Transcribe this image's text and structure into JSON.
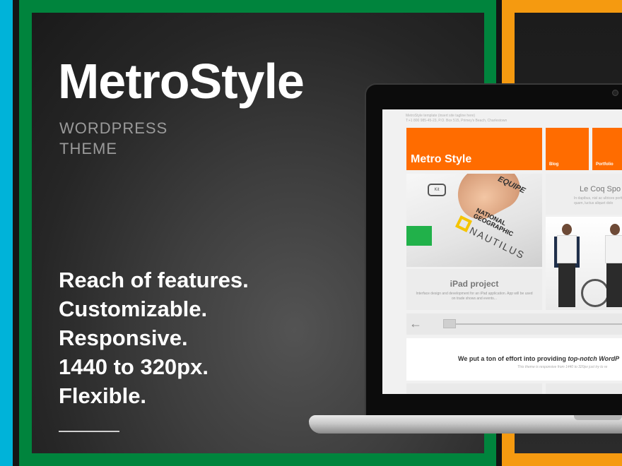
{
  "banner": {
    "title": "MetroStyle",
    "subtitle_line1": "WORDPRESS",
    "subtitle_line2": "THEME",
    "features": [
      "Reach of features.",
      "Customizable.",
      "Responsive.",
      "1440 to 320px.",
      "Flexible."
    ]
  },
  "colors": {
    "blue": "#00b3d9",
    "green": "#00843d",
    "orange": "#f59a10",
    "tile_orange": "#ff6c00",
    "panel_dark": "#2a2a2a"
  },
  "laptop_screen": {
    "header_line1": "MetroStyle template (insert site tagline here)",
    "header_line2": "T:+1 800 985-45-23, P.O. Box 515, Primey's Beach, Charlestown",
    "tile_main": "Metro Style",
    "tile_blog": "Blog",
    "tile_portfolio": "Portfolio",
    "ipad_bubble": "Kit",
    "ipad_ng_line1": "NATIONAL",
    "ipad_ng_line2": "GEOGRAPHIC",
    "ipad_nautilus": "NAUTILUS",
    "ipad_equipe": "EQUIPE",
    "card_title": "iPad project",
    "card_desc": "Interface design and development for an iPad application. App will be used on trade shows and events...",
    "lecoq_title": "Le Coq Spo",
    "lecoq_desc": "In dapibus, nisl ac ultrices porttitor quam, luctus aliquet dolo",
    "arrow_icon": "←",
    "promo_prefix": "We put a ton of effort into providing ",
    "promo_emph": "top-notch WordP",
    "promo_sub": "This theme is responsive from 1440 to 320px just try to re"
  }
}
